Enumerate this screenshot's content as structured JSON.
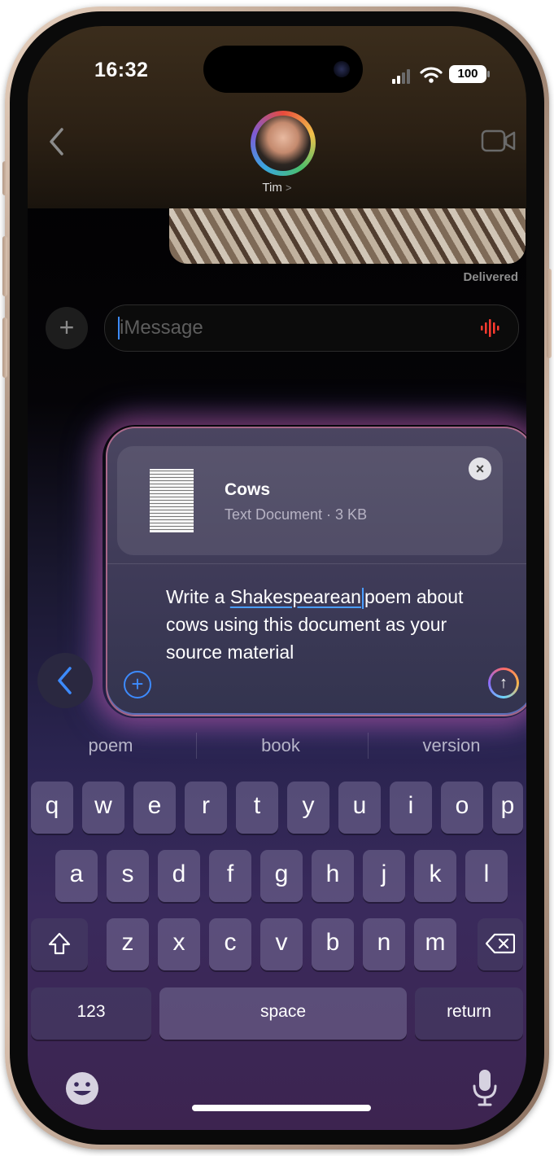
{
  "status": {
    "time": "16:32",
    "battery": "100"
  },
  "header": {
    "contact_name": "Tim",
    "name_chevron": ">"
  },
  "thread": {
    "delivered": "Delivered"
  },
  "compose": {
    "placeholder": "iMessage"
  },
  "writing_tools": {
    "attachment": {
      "title": "Cows",
      "meta": "Text Document · 3 KB"
    },
    "prompt_before": "Write a ",
    "prompt_word": "Shakespearean",
    "prompt_after": "poem about cows using this document as your source material"
  },
  "suggestions": [
    "poem",
    "book",
    "version"
  ],
  "keyboard": {
    "row1": [
      "q",
      "w",
      "e",
      "r",
      "t",
      "y",
      "u",
      "i",
      "o",
      "p"
    ],
    "row2": [
      "a",
      "s",
      "d",
      "f",
      "g",
      "h",
      "j",
      "k",
      "l"
    ],
    "row3": [
      "z",
      "x",
      "c",
      "v",
      "b",
      "n",
      "m"
    ],
    "numbers_label": "123",
    "space_label": "space",
    "return_label": "return"
  },
  "colors": {
    "accent": "#3d8bff",
    "recording": "#ff3b30"
  },
  "icons": [
    "back-chevron-icon",
    "video-icon",
    "plus-icon",
    "waveform-icon",
    "close-icon",
    "add-icon",
    "send-arrow-icon",
    "shift-icon",
    "delete-icon",
    "emoji-icon",
    "mic-icon"
  ]
}
